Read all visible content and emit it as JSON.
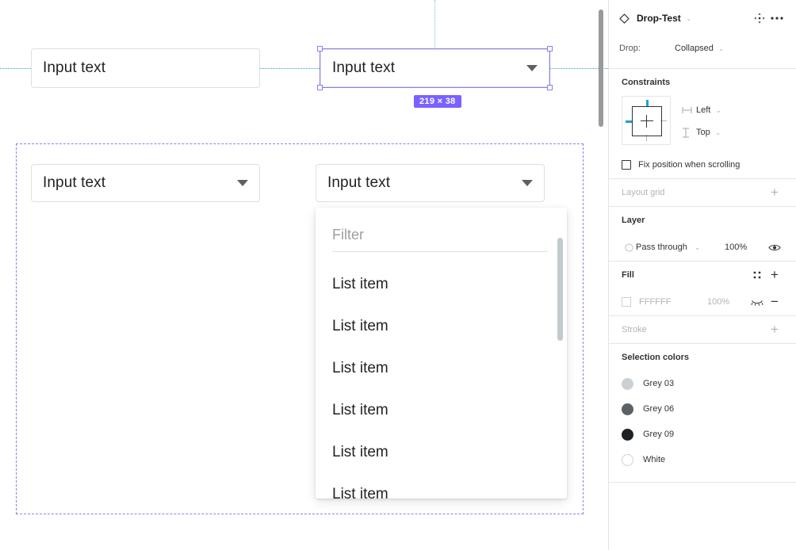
{
  "canvas": {
    "controls": [
      {
        "label": "Input text",
        "has_caret": false
      },
      {
        "label": "Input text",
        "has_caret": true
      },
      {
        "label": "Input text",
        "has_caret": true
      },
      {
        "label": "Input text",
        "has_caret": true
      }
    ],
    "selection": {
      "size_badge": "219 × 38"
    },
    "dropdown": {
      "filter_placeholder": "Filter",
      "items": [
        "List item",
        "List item",
        "List item",
        "List item",
        "List item",
        "List item"
      ]
    }
  },
  "panel": {
    "header": {
      "title": "Drop-Test",
      "chevron": "⌄",
      "resize_icon": "move-resize-icon",
      "more_icon": "more-options-icon"
    },
    "component_prop": {
      "key": "Drop:",
      "value": "Collapsed",
      "chevron": "⌄"
    },
    "constraints": {
      "title": "Constraints",
      "horizontal": "Left",
      "vertical": "Top",
      "chevron": "⌄",
      "fix_position_label": "Fix position when scrolling"
    },
    "layout_grid": {
      "title": "Layout grid",
      "add": "+"
    },
    "layer": {
      "title": "Layer",
      "blend_mode": "Pass through",
      "chevron": "⌄",
      "opacity": "100%",
      "visibility_icon": "eye-icon"
    },
    "fill": {
      "title": "Fill",
      "styles_icon": "four-dot-grid-icon",
      "add": "+",
      "hex": "FFFFFF",
      "opacity": "100%",
      "hide_icon": "eye-closed-icon",
      "remove": "−"
    },
    "stroke": {
      "title": "Stroke",
      "add": "+"
    },
    "selection_colors": {
      "title": "Selection colors",
      "items": [
        {
          "label": "Grey 03",
          "color": "#CBD0D4"
        },
        {
          "label": "Grey 06",
          "color": "#5C6165"
        },
        {
          "label": "Grey 09",
          "color": "#1E2124"
        },
        {
          "label": "White",
          "color": "#FFFFFF"
        }
      ]
    }
  }
}
